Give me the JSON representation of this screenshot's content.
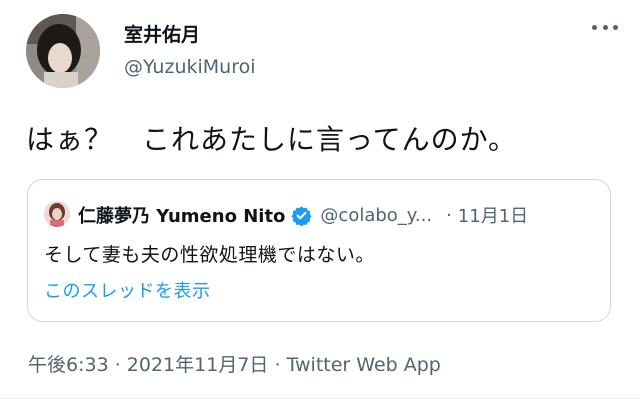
{
  "tweet": {
    "author": {
      "display_name": "室井佑月",
      "handle": "@YuzukiMuroi"
    },
    "text": "はぁ？　これあたしに言ってんのか。",
    "more_icon": "more-horizontal-icon",
    "quoted": {
      "display_name": "仁藤夢乃 Yumeno Nito",
      "verified_icon": "verified-badge-icon",
      "verified_color": "#1d9bf0",
      "handle": "@colabo_y...",
      "separator": "·",
      "date": "11月1日",
      "text": "そして妻も夫の性欲処理機ではない。",
      "thread_link": "このスレッドを表示"
    },
    "meta": {
      "time": "午後6:33",
      "sep1": " · ",
      "date": "2021年11月7日",
      "sep2": " · ",
      "source": "Twitter Web App"
    }
  },
  "colors": {
    "text": "#0f1419",
    "secondary": "#536471",
    "link": "#1d9bf0",
    "border": "#cfd9de"
  }
}
